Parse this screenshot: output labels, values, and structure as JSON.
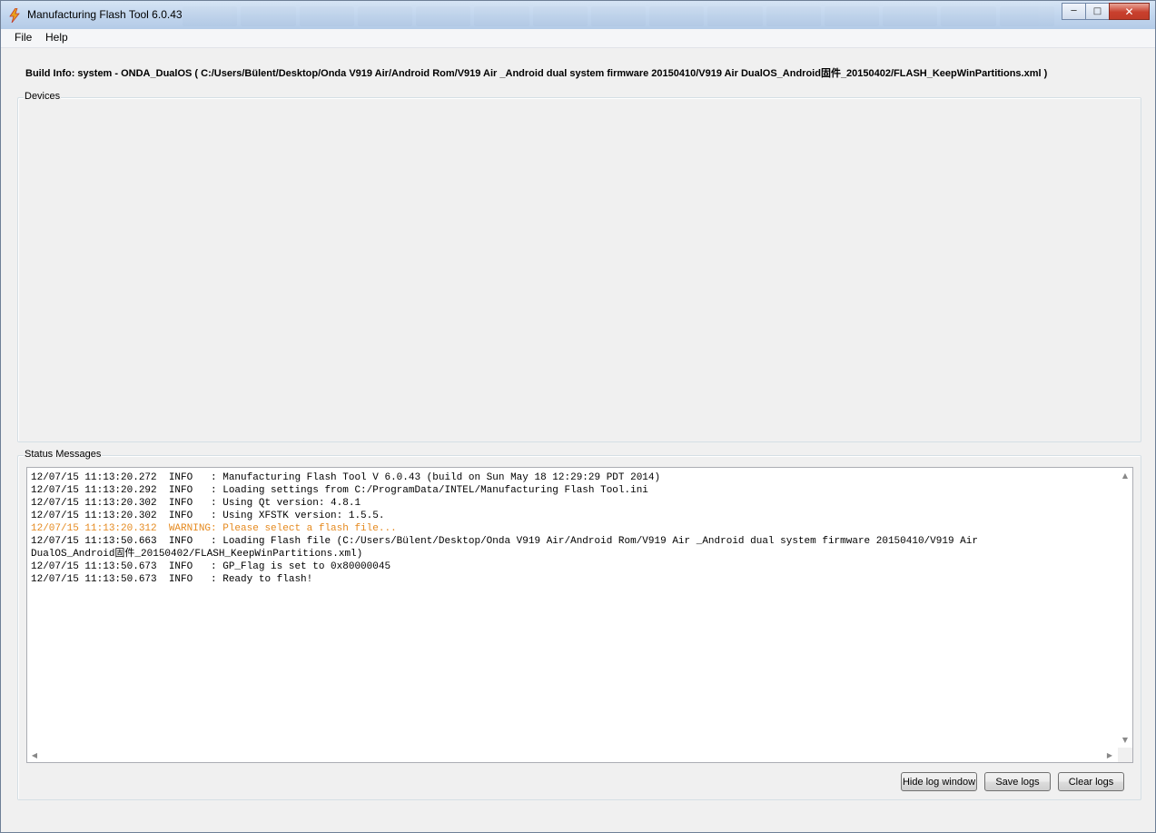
{
  "window": {
    "title": "Manufacturing Flash Tool 6.0.43",
    "controls": {
      "minimize": "─",
      "maximize": "□",
      "close": "✕"
    },
    "background_taskbar": [
      "",
      "",
      "",
      "",
      "",
      "",
      "",
      "",
      "",
      "",
      "",
      "",
      "",
      "",
      ""
    ]
  },
  "menu": {
    "file": "File",
    "help": "Help"
  },
  "build_info": "Build Info:  system - ONDA_DualOS ( C:/Users/Bülent/Desktop/Onda V919 Air/Android Rom/V919 Air _Android dual system firmware 20150410/V919 Air DualOS_Android固件_20150402/FLASH_KeepWinPartitions.xml )",
  "devices": {
    "label": "Devices"
  },
  "status": {
    "label": "Status Messages",
    "log": [
      {
        "text": "12/07/15 11:13:20.272  INFO   : Manufacturing Flash Tool V 6.0.43 (build on Sun May 18 12:29:29 PDT 2014)",
        "level": "info"
      },
      {
        "text": "12/07/15 11:13:20.292  INFO   : Loading settings from C:/ProgramData/INTEL/Manufacturing Flash Tool.ini",
        "level": "info"
      },
      {
        "text": "12/07/15 11:13:20.302  INFO   : Using Qt version: 4.8.1",
        "level": "info"
      },
      {
        "text": "12/07/15 11:13:20.302  INFO   : Using XFSTK version: 1.5.5.",
        "level": "info"
      },
      {
        "text": "12/07/15 11:13:20.312  WARNING: Please select a flash file...",
        "level": "warning"
      },
      {
        "text": "12/07/15 11:13:50.663  INFO   : Loading Flash file (C:/Users/Bülent/Desktop/Onda V919 Air/Android Rom/V919 Air _Android dual system firmware 20150410/V919 Air",
        "level": "info"
      },
      {
        "text": "DualOS_Android固件_20150402/FLASH_KeepWinPartitions.xml)",
        "level": "info"
      },
      {
        "text": "12/07/15 11:13:50.673  INFO   : GP_Flag is set to 0x80000045",
        "level": "info"
      },
      {
        "text": "12/07/15 11:13:50.673  INFO   : Ready to flash!",
        "level": "info"
      }
    ],
    "warning_color": "#e58a1f"
  },
  "buttons": {
    "hide_log": "Hide log window",
    "save_logs": "Save logs",
    "clear_logs": "Clear logs"
  }
}
